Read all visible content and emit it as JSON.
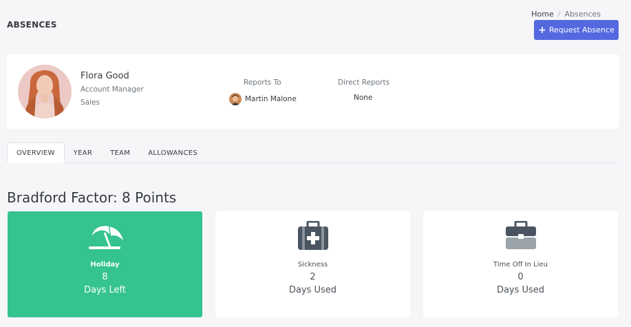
{
  "header": {
    "title": "ABSENCES",
    "breadcrumb": {
      "home": "Home",
      "separator": "/",
      "current": "Absences"
    },
    "request_button": {
      "icon": "plus-icon",
      "label": "Request Absence"
    }
  },
  "profile": {
    "name": "Flora Good",
    "role": "Account Manager",
    "department": "Sales",
    "reports_to_label": "Reports To",
    "reports_to_name": "Martin Malone",
    "direct_reports_label": "Direct Reports",
    "direct_reports_value": "None"
  },
  "tabs": [
    {
      "label": "OVERVIEW",
      "active": true
    },
    {
      "label": "YEAR",
      "active": false
    },
    {
      "label": "TEAM",
      "active": false
    },
    {
      "label": "ALLOWANCES",
      "active": false
    }
  ],
  "bradford": {
    "text": "Bradford Factor: 8 Points"
  },
  "cards": [
    {
      "icon": "beach-umbrella-icon",
      "label": "Holiday",
      "value": "8",
      "unit": "Days Left",
      "color": "#35c38f"
    },
    {
      "icon": "first-aid-kit-icon",
      "label": "Sickness",
      "value": "2",
      "unit": "Days Used"
    },
    {
      "icon": "briefcase-icon",
      "label": "Time Off In Lieu",
      "value": "0",
      "unit": "Days Used"
    }
  ],
  "colors": {
    "primary": "#5469e0",
    "success": "#35c38f",
    "background": "#f6f6f9",
    "icon_dark": "#4a5561"
  }
}
